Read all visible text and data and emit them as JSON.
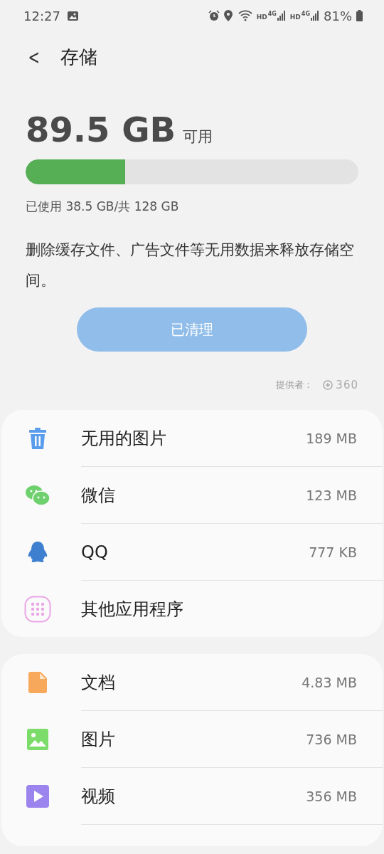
{
  "status_bar": {
    "time": "12:27",
    "network": [
      {
        "label": "HD",
        "type": "4G"
      },
      {
        "label": "HD",
        "type": "4G"
      }
    ],
    "battery": "81%"
  },
  "header": {
    "back": "<",
    "title": "存储"
  },
  "summary": {
    "available": "89.5 GB",
    "available_label": "可用",
    "level": 0.3,
    "used": "已使用 38.5 GB/共 128 GB"
  },
  "description": "删除缓存文件、广告文件等无用数据来释放存储空间。",
  "clean_button": {
    "label": "已清理",
    "disabled": true
  },
  "provider": {
    "label": "提供者：",
    "logo_text": "360"
  },
  "cards": [
    {
      "items": [
        {
          "kind": "trash",
          "name": "无用的图片",
          "size": "189 MB"
        },
        {
          "kind": "chat",
          "name": "微信",
          "size": "123 MB"
        },
        {
          "kind": "penguin",
          "name": "QQ",
          "size": "777 KB"
        },
        {
          "kind": "apps",
          "name": "其他应用程序"
        }
      ]
    },
    {
      "items": [
        {
          "kind": "document",
          "name": "文档",
          "size": "4.83 MB"
        },
        {
          "kind": "image",
          "name": "图片",
          "size": "736 MB"
        },
        {
          "kind": "video",
          "name": "视频",
          "size": "356 MB"
        }
      ]
    }
  ]
}
